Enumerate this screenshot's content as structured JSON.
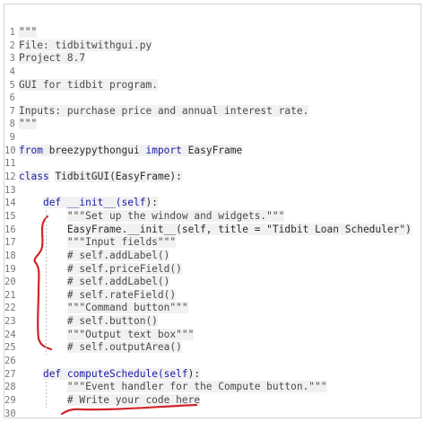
{
  "editor": {
    "lines": [
      {
        "num": "1",
        "segments": [
          {
            "t": "\"\"\"",
            "c": "comment"
          }
        ]
      },
      {
        "num": "2",
        "segments": [
          {
            "t": "File: ",
            "c": "comment"
          },
          {
            "t": "tid",
            "c": "comment hl"
          },
          {
            "t": "bitwithgui.py",
            "c": "comment"
          }
        ]
      },
      {
        "num": "3",
        "segments": [
          {
            "t": "Project 8.7",
            "c": "comment"
          }
        ]
      },
      {
        "num": "4",
        "segments": []
      },
      {
        "num": "5",
        "segments": [
          {
            "t": "GUI for ",
            "c": "comment"
          },
          {
            "t": "tid",
            "c": "comment hl"
          },
          {
            "t": "bit program.",
            "c": "comment"
          }
        ]
      },
      {
        "num": "6",
        "segments": []
      },
      {
        "num": "7",
        "segments": [
          {
            "t": "Inputs: purchase price and annual interest rate.",
            "c": "comment"
          }
        ]
      },
      {
        "num": "8",
        "segments": [
          {
            "t": "\"\"\"",
            "c": "comment"
          }
        ]
      },
      {
        "num": "9",
        "segments": []
      },
      {
        "num": "10",
        "segments": [
          {
            "t": "from",
            "c": "kw"
          },
          {
            "t": " breezypythongui ",
            "c": "plain"
          },
          {
            "t": "import",
            "c": "kw"
          },
          {
            "t": " EasyFrame",
            "c": "plain"
          }
        ]
      },
      {
        "num": "11",
        "segments": []
      },
      {
        "num": "12",
        "segments": [
          {
            "t": "class",
            "c": "kw"
          },
          {
            "t": " ",
            "c": "plain"
          },
          {
            "t": "Tid",
            "c": "plain hl"
          },
          {
            "t": "bitGUI(EasyFrame):",
            "c": "plain"
          }
        ]
      },
      {
        "num": "13",
        "segments": []
      },
      {
        "num": "14",
        "segments": [
          {
            "t": "    ",
            "c": "plain"
          },
          {
            "t": "def",
            "c": "kw"
          },
          {
            "t": " __init__(",
            "c": "fn"
          },
          {
            "t": "self",
            "c": "kw"
          },
          {
            "t": "):",
            "c": "plain"
          }
        ]
      },
      {
        "num": "15",
        "segments": [
          {
            "t": "        ",
            "c": "plain"
          },
          {
            "t": "\"\"\"Set up the window and widgets.\"\"\"",
            "c": "comment"
          }
        ]
      },
      {
        "num": "16",
        "segments": [
          {
            "t": "        ",
            "c": "plain"
          },
          {
            "t": "EasyFrame.__init__(self, title = \"",
            "c": "plain"
          },
          {
            "t": "Tid",
            "c": "plain hl"
          },
          {
            "t": "bit Loan Scheduler\")",
            "c": "plain"
          }
        ]
      },
      {
        "num": "17",
        "segments": [
          {
            "t": "        ",
            "c": "plain"
          },
          {
            "t": "\"\"\"Input fields\"\"\"",
            "c": "comment"
          }
        ]
      },
      {
        "num": "18",
        "segments": [
          {
            "t": "        ",
            "c": "plain"
          },
          {
            "t": "# self.addLabel()",
            "c": "comment"
          }
        ]
      },
      {
        "num": "19",
        "segments": [
          {
            "t": "        ",
            "c": "plain"
          },
          {
            "t": "# self.priceField()",
            "c": "comment"
          }
        ]
      },
      {
        "num": "20",
        "segments": [
          {
            "t": "        ",
            "c": "plain"
          },
          {
            "t": "# self.addLabel()",
            "c": "comment"
          }
        ]
      },
      {
        "num": "21",
        "segments": [
          {
            "t": "        ",
            "c": "plain"
          },
          {
            "t": "# self.rateField()",
            "c": "comment"
          }
        ]
      },
      {
        "num": "22",
        "segments": [
          {
            "t": "        ",
            "c": "plain"
          },
          {
            "t": "\"\"\"Command button\"\"\"",
            "c": "comment"
          }
        ]
      },
      {
        "num": "23",
        "segments": [
          {
            "t": "        ",
            "c": "plain"
          },
          {
            "t": "# self.button()",
            "c": "comment"
          }
        ]
      },
      {
        "num": "24",
        "segments": [
          {
            "t": "        ",
            "c": "plain"
          },
          {
            "t": "\"\"\"Output text box\"\"\"",
            "c": "comment"
          }
        ]
      },
      {
        "num": "25",
        "segments": [
          {
            "t": "        ",
            "c": "plain"
          },
          {
            "t": "# self.outputArea()",
            "c": "comment"
          }
        ]
      },
      {
        "num": "26",
        "segments": []
      },
      {
        "num": "27",
        "segments": [
          {
            "t": "    ",
            "c": "plain"
          },
          {
            "t": "def",
            "c": "kw"
          },
          {
            "t": " computeSchedule(",
            "c": "fn"
          },
          {
            "t": "self",
            "c": "kw"
          },
          {
            "t": "):",
            "c": "plain"
          }
        ]
      },
      {
        "num": "28",
        "segments": [
          {
            "t": "        ",
            "c": "plain"
          },
          {
            "t": "\"\"\"Event handler for the Compute button.\"\"\"",
            "c": "comment"
          }
        ]
      },
      {
        "num": "29",
        "segments": [
          {
            "t": "        ",
            "c": "plain"
          },
          {
            "t": "# Write your code here",
            "c": "comment"
          }
        ]
      },
      {
        "num": "30",
        "segments": []
      }
    ]
  },
  "annotations": {
    "ink_color": "#d0262c"
  }
}
